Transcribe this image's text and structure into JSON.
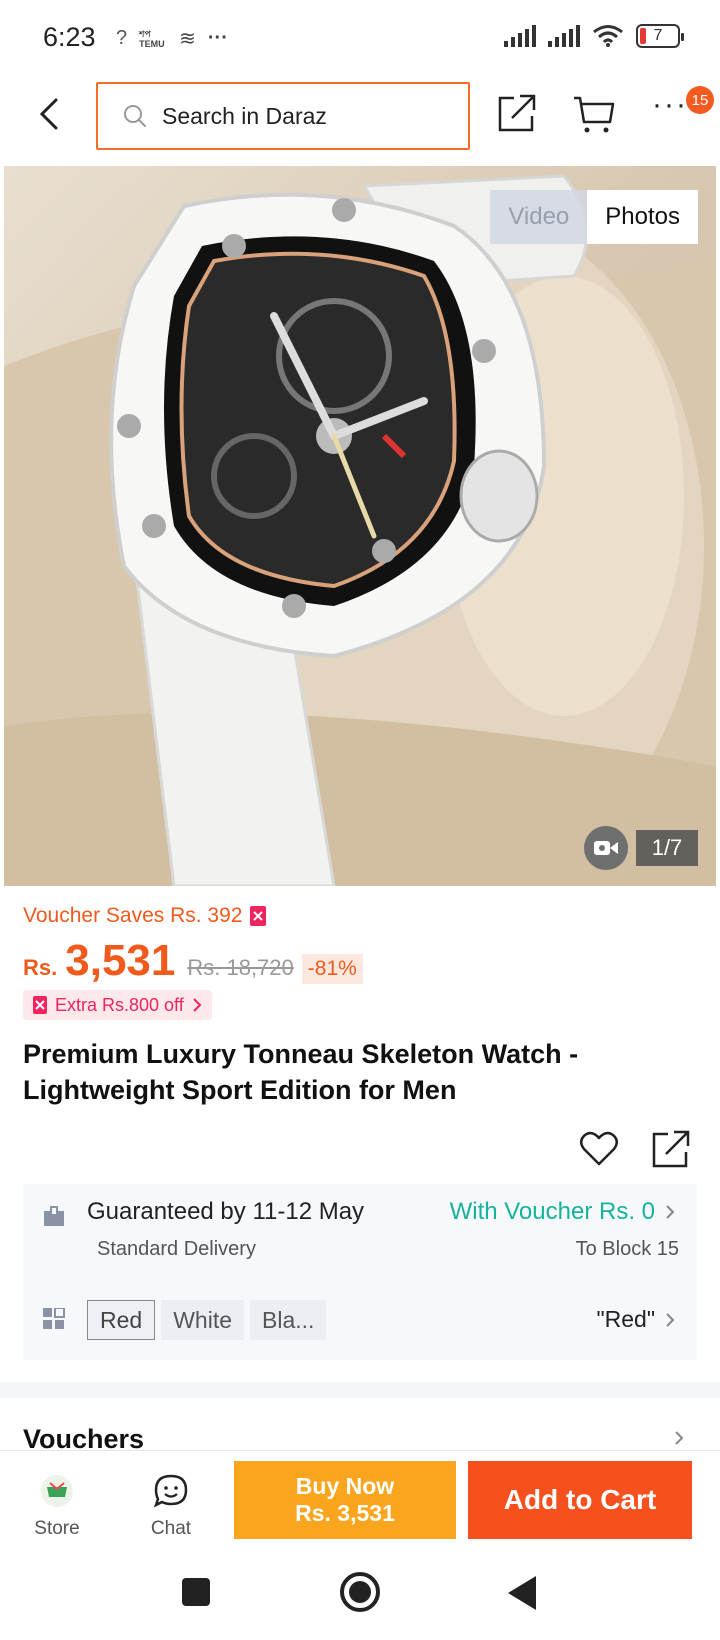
{
  "status_bar": {
    "time": "6:23",
    "small_icons": [
      "?",
      "শপ TEMU",
      "≋",
      "···"
    ],
    "battery": "7"
  },
  "header": {
    "search_placeholder": "Search in Daraz",
    "notification_count": "15"
  },
  "gallery": {
    "tabs": [
      {
        "label": "Video",
        "active": false
      },
      {
        "label": "Photos",
        "active": true
      }
    ],
    "counter": "1/7"
  },
  "price": {
    "voucher_saves": "Voucher Saves Rs. 392",
    "currency": "Rs.",
    "current": "3,531",
    "original": "Rs. 18,720",
    "discount": "-81%",
    "extra_off": "Extra Rs.800 off"
  },
  "product": {
    "title": "Premium Luxury Tonneau Skeleton Watch - Lightweight Sport Edition for Men"
  },
  "delivery": {
    "guarantee": "Guaranteed by 11-12 May",
    "type": "Standard Delivery",
    "voucher": "With Voucher Rs. 0",
    "location": "To Block 15"
  },
  "variants": {
    "options": [
      "Red",
      "White",
      "Bla..."
    ],
    "selected_label": "\"Red\""
  },
  "sections": {
    "vouchers": "Vouchers"
  },
  "action_bar": {
    "store": "Store",
    "chat": "Chat",
    "buy_now_line1": "Buy Now",
    "buy_now_line2": "Rs. 3,531",
    "add_to_cart": "Add to Cart"
  },
  "colors": {
    "brand_orange": "#f5501d",
    "buy_now_yellow": "#f9a51d",
    "voucher_teal": "#16b39a",
    "extra_pink": "#f0245f"
  }
}
